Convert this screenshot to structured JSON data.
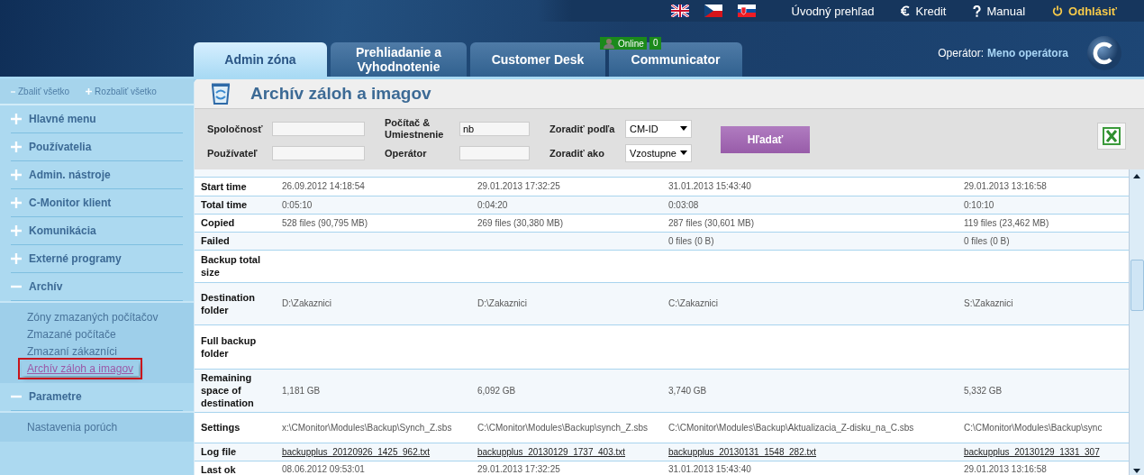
{
  "top_links": [
    {
      "kind": "home",
      "label": "Úvodný prehľad"
    },
    {
      "kind": "credit",
      "label": "Kredit"
    },
    {
      "kind": "help",
      "label": "Manual"
    },
    {
      "kind": "logout",
      "label": "Odhlásiť"
    }
  ],
  "languages": [
    {
      "kind": "en"
    },
    {
      "kind": "cz"
    },
    {
      "kind": "sk"
    }
  ],
  "tabs": [
    {
      "label": "Admin zóna",
      "selected": true
    },
    {
      "label": "Prehliadanie a Vyhodnotenie",
      "selected": false
    },
    {
      "label": "Customer Desk",
      "selected": false
    },
    {
      "label": "Communicator",
      "selected": false,
      "badge": {
        "label": "Online",
        "count": "0"
      }
    }
  ],
  "operator": {
    "label": "Operátor:",
    "name": "Meno operátora"
  },
  "sidebar": {
    "collapse_all": "Zbaliť všetko",
    "expand_all": "Rozbaliť všetko",
    "sections": [
      {
        "label": "Hlavné menu",
        "expanded": false
      },
      {
        "label": "Používatelia",
        "expanded": false
      },
      {
        "label": "Admin. nástroje",
        "expanded": false
      },
      {
        "label": "C-Monitor klient",
        "expanded": false
      },
      {
        "label": "Komunikácia",
        "expanded": false
      },
      {
        "label": "Externé programy",
        "expanded": false
      },
      {
        "label": "Archív",
        "expanded": true,
        "children": [
          {
            "label": "Zóny zmazaných počítačov",
            "selected": false
          },
          {
            "label": "Zmazané počítače",
            "selected": false
          },
          {
            "label": "Zmazaní zákazníci",
            "selected": false
          },
          {
            "label": "Archív záloh a imagov",
            "selected": true
          }
        ]
      },
      {
        "label": "Parametre",
        "expanded": true,
        "children": [
          {
            "label": "Nastavenia porúch",
            "selected": false
          }
        ]
      }
    ]
  },
  "page_title": "Archív záloh a imagov",
  "filters": {
    "company": {
      "label": "Spoločnosť"
    },
    "user": {
      "label": "Používateľ"
    },
    "computer": {
      "label": "Počítač & Umiestnenie",
      "value": "nb"
    },
    "operator": {
      "label": "Operátor"
    },
    "sort_by": {
      "label": "Zoradiť podľa",
      "value": "CM-ID"
    },
    "sort_order": {
      "label": "Zoradiť ako",
      "value": "Vzostupne"
    },
    "search_button": "Hľadať"
  },
  "table": {
    "rows": [
      {
        "label": "Start time",
        "cells": [
          "26.09.2012 14:18:54",
          "29.01.2013 17:32:25",
          "31.01.2013 15:43:40",
          "29.01.2013 13:16:58"
        ]
      },
      {
        "label": "Total time",
        "cells": [
          "0:05:10",
          "0:04:20",
          "0:03:08",
          "0:10:10"
        ]
      },
      {
        "label": "Copied",
        "cells": [
          "528 files (90,795 MB)",
          "269 files (30,380 MB)",
          "287 files (30,601 MB)",
          "119 files (23,462 MB)"
        ]
      },
      {
        "label": "Failed",
        "cells": [
          "",
          "",
          "0 files (0 B)",
          "0 files (0 B)"
        ]
      },
      {
        "label": "Backup total size",
        "cells": [
          "",
          "",
          "",
          ""
        ]
      },
      {
        "label": "Destination folder",
        "cells": [
          "D:\\Zakaznici",
          "D:\\Zakaznici",
          "C:\\Zakaznici",
          "S:\\Zakaznici"
        ]
      },
      {
        "label": "Full backup folder",
        "cells": [
          "",
          "",
          "",
          ""
        ]
      },
      {
        "label": "Remaining space of destination",
        "cells": [
          "1,181 GB",
          "6,092 GB",
          "3,740 GB",
          "5,332 GB"
        ]
      },
      {
        "label": "Settings",
        "cells": [
          "x:\\CMonitor\\Modules\\Backup\\Synch_Z.sbs",
          "C:\\CMonitor\\Modules\\Backup\\synch_Z.sbs",
          "C:\\CMonitor\\Modules\\Backup\\Aktualizacia_Z-disku_na_C.sbs",
          "C:\\CMonitor\\Modules\\Backup\\sync"
        ]
      },
      {
        "label": "Log file",
        "kind": "link",
        "cells": [
          "backupplus_20120926_1425_962.txt",
          "backupplus_20130129_1737_403.txt",
          "backupplus_20130131_1548_282.txt",
          "backupplus_20130129_1331_307"
        ]
      },
      {
        "label": "Last ok",
        "cells": [
          "08.06.2012 09:53:01",
          "29.01.2013 17:32:25",
          "31.01.2013 15:43:40",
          "29.01.2013 13:16:58"
        ]
      }
    ]
  }
}
